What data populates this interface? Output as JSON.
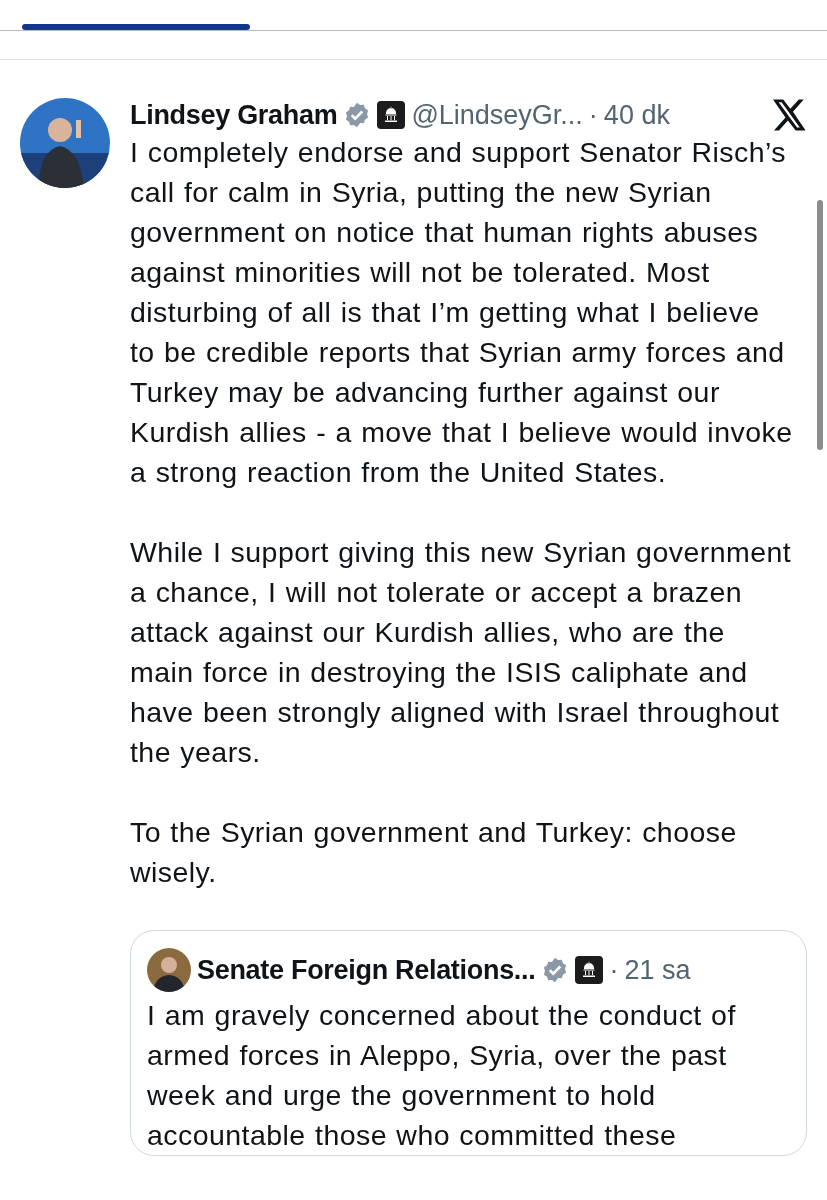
{
  "tabs": [
    {
      "selected": true
    },
    {
      "selected": false
    }
  ],
  "post": {
    "author": "Lindsey Graham",
    "verified": true,
    "affiliate_badge": true,
    "handle": "@LindseyGr...",
    "separator": "·",
    "time": "40 dk",
    "paragraphs": [
      "I completely endorse and support Senator Risch’s call for calm in Syria, putting the new Syrian government on notice that human rights abuses against minorities will not be tolerated. Most disturbing of all is that I’m getting what I believe to be credible reports that Syrian army forces and Turkey may be advancing further against our Kurdish allies - a move that I believe would invoke a strong reaction from the United States.",
      "While I support giving this new Syrian government a chance, I will not tolerate or accept a brazen attack against our Kurdish allies, who are the main force in destroying the ISIS caliphate and have been strongly aligned with Israel throughout the years.",
      "To the Syrian government and Turkey: choose wisely."
    ],
    "quote": {
      "author": "Senate Foreign Relations...",
      "verified": true,
      "affiliate_badge": true,
      "separator": "·",
      "time": "21 sa",
      "text": "I am gravely concerned about the conduct of armed forces in Aleppo, Syria, over the past week and urge the government to hold accountable those who committed these"
    }
  }
}
